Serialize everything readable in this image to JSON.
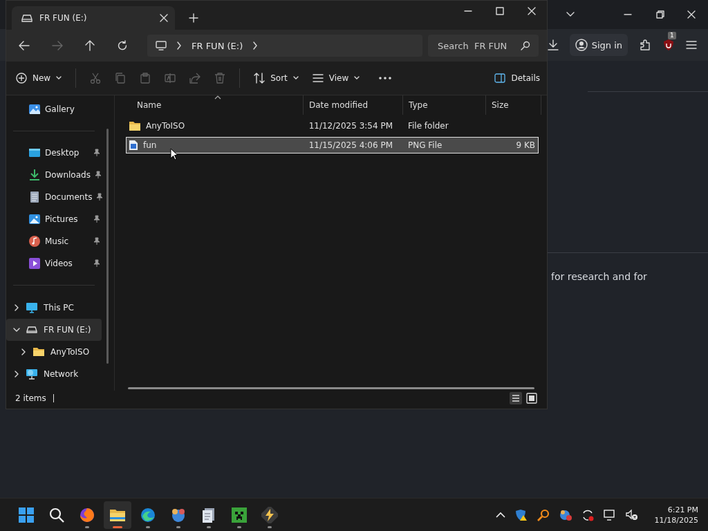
{
  "browser": {
    "sign_in": "Sign in",
    "extension_badge": "1",
    "page_text": "for research and for"
  },
  "explorer": {
    "tab_title": "FR FUN (E:)",
    "breadcrumb": [
      "FR FUN (E:)"
    ],
    "search": {
      "placeholder": "Search  FR FUN"
    },
    "new_label": "New",
    "edit_tools": [
      {
        "disabled": true
      },
      {
        "disabled": true
      },
      {
        "disabled": true
      },
      {
        "disabled": true
      },
      {
        "disabled": true
      },
      {
        "disabled": true
      }
    ],
    "sort_label": "Sort",
    "view_label": "View",
    "details_label": "Details",
    "quick_access": [
      {
        "label": "Gallery",
        "pinned": false
      },
      {
        "label": "Desktop",
        "pinned": true
      },
      {
        "label": "Downloads",
        "pinned": true
      },
      {
        "label": "Documents",
        "pinned": true
      },
      {
        "label": "Pictures",
        "pinned": true
      },
      {
        "label": "Music",
        "pinned": true
      },
      {
        "label": "Videos",
        "pinned": true
      }
    ],
    "tree": [
      {
        "label": "This PC",
        "expanded": false,
        "selected": false
      },
      {
        "label": "FR FUN (E:)",
        "expanded": true,
        "selected": true,
        "children": [
          {
            "label": "AnyToISO",
            "expanded": false,
            "selected": false
          }
        ]
      },
      {
        "label": "Network",
        "expanded": false,
        "selected": false
      }
    ],
    "columns": [
      "Name",
      "Date modified",
      "Type",
      "Size"
    ],
    "rows": [
      {
        "kind": "folder",
        "name": "AnyToISO",
        "date": "11/12/2025 3:54 PM",
        "type": "File folder",
        "selected": false
      },
      {
        "kind": "image",
        "name": "fun",
        "date": "11/15/2025 4:06 PM",
        "type": "PNG File",
        "size": "9 KB",
        "selected": true
      }
    ],
    "status": "2 items"
  },
  "taskbar": {
    "apps": [
      {
        "active": false
      },
      {
        "active": false
      },
      {
        "active": false
      },
      {
        "active": true
      },
      {
        "active": false
      },
      {
        "active": false
      },
      {
        "active": false
      },
      {
        "active": false
      },
      {
        "active": false
      }
    ],
    "time": "6:21 PM",
    "date": "11/18/2025"
  }
}
